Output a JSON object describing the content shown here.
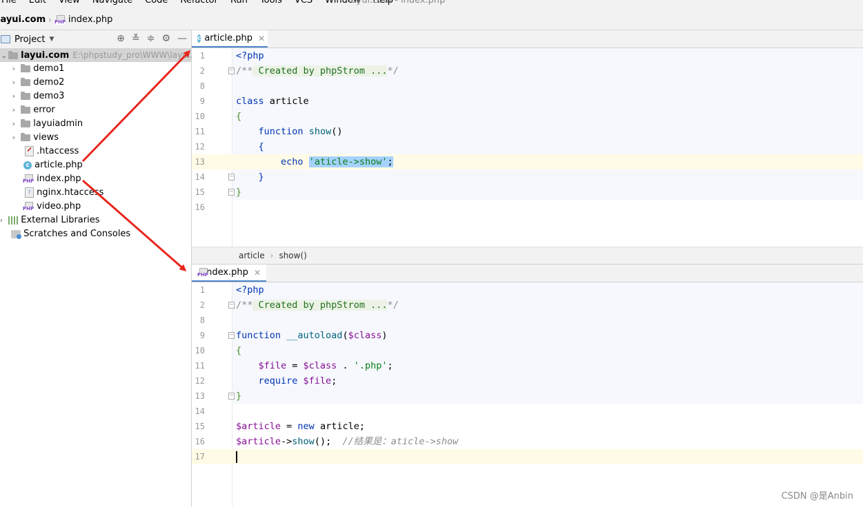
{
  "menu": [
    "File",
    "Edit",
    "View",
    "Navigate",
    "Code",
    "Refactor",
    "Run",
    "Tools",
    "VCS",
    "Window",
    "Help"
  ],
  "window_title": "layui.com - index.php",
  "navbar": {
    "project": "layui.com",
    "file": "index.php"
  },
  "sidebar": {
    "header_label": "Project",
    "tree": {
      "root": {
        "name": "layui.com",
        "path": "E:\\phpstudy_pro\\WWW\\layui.co"
      },
      "folders": [
        "demo1",
        "demo2",
        "demo3",
        "error",
        "layuiadmin",
        "views"
      ],
      "files": [
        ".htaccess",
        "article.php",
        "index.php",
        "nginx.htaccess",
        "video.php"
      ],
      "external": "External Libraries",
      "scratches": "Scratches and Consoles"
    }
  },
  "top_editor": {
    "tab": "article.php",
    "line_numbers": [
      "1",
      "2",
      "8",
      "9",
      "10",
      "11",
      "12",
      "13",
      "14",
      "15",
      "16"
    ],
    "code": {
      "l1": "<?php",
      "l2_open": "/**",
      "l2_comment": " Created by phpStrom ...",
      "l2_close": "*/",
      "l9_kw": "class",
      "l9_name": " article",
      "l10": "{",
      "l11_kw": "function",
      "l11_fn": "show",
      "l11_paren": "()",
      "l12": "{",
      "l13_kw": "echo",
      "l13_str": "'aticle->show'",
      "l13_semi": ";",
      "l14": "}",
      "l15": "}"
    }
  },
  "breadcrumb": {
    "class": "article",
    "method": "show()"
  },
  "bottom_editor": {
    "tab": "index.php",
    "line_numbers": [
      "1",
      "2",
      "8",
      "9",
      "10",
      "11",
      "12",
      "13",
      "14",
      "15",
      "16",
      "17"
    ],
    "code": {
      "l1": "<?php",
      "l2_open": "/**",
      "l2_comment": " Created by phpStrom ...",
      "l2_close": "*/",
      "l9_kw": "function",
      "l9_fn": " __autoload",
      "l9_open": "(",
      "l9_var": "$class",
      "l9_close": ")",
      "l10": "{",
      "l11_var1": "$file",
      "l11_eq": " = ",
      "l11_var2": "$class",
      "l11_dot": " . ",
      "l11_str": "'.php'",
      "l11_semi": ";",
      "l12_kw": "require",
      "l12_var": " $file",
      "l12_semi": ";",
      "l13": "}",
      "l15_var": "$article",
      "l15_eq": " = ",
      "l15_kw": "new",
      "l15_cls": " article;",
      "l16_var": "$article",
      "l16_arrow": "->",
      "l16_fn": "show",
      "l16_rest": "();  ",
      "l16_comment": "//结果是：aticle->show"
    }
  },
  "watermark": "CSDN @是Anbin",
  "colors": {
    "accent": "#4a83c9",
    "annotation_arrow": "#e8251d"
  }
}
